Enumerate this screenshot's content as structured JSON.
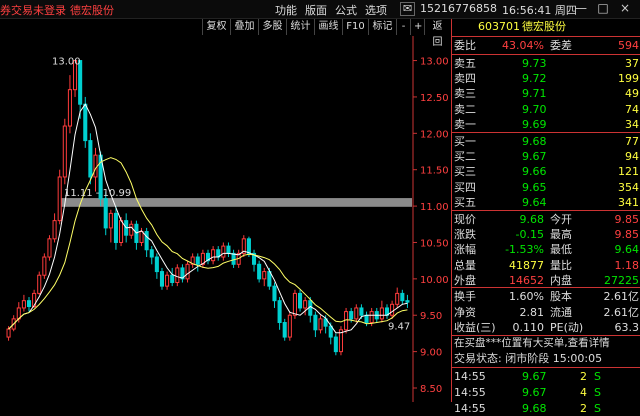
{
  "topbar": {
    "left_text": "券交易未登录",
    "stock_name": "德宏股份",
    "menu": [
      "功能",
      "版面",
      "公式",
      "选项"
    ],
    "phone": "15216776858",
    "time": "16:56:41 周四",
    "win_buttons": [
      "—",
      "□",
      "×"
    ]
  },
  "toolbar": {
    "buttons": [
      "复权",
      "叠加",
      "多股",
      "统计",
      "画线",
      "F10",
      "标记",
      "-",
      "+",
      "返回"
    ]
  },
  "chart": {
    "y_ticks": [
      "13.00",
      "12.50",
      "12.00",
      "11.50",
      "11.00",
      "10.50",
      "10.00",
      "9.50",
      "9.00",
      "8.50"
    ],
    "high_label": "13.00",
    "range_label": "11.11 - 10.99",
    "last_label": "9.47",
    "colors": {
      "up": "#ff3c3c",
      "down": "#00d0d0",
      "ma1": "#ffffff",
      "ma2": "#ffff66",
      "band": "#9a9a9a"
    }
  },
  "chart_data": {
    "type": "candlestick",
    "ylim": [
      8.5,
      13.2
    ],
    "candles": [
      [
        9.2,
        9.31,
        9.35,
        9.15
      ],
      [
        9.31,
        9.45,
        9.5,
        9.28
      ],
      [
        9.45,
        9.6,
        9.68,
        9.4
      ],
      [
        9.6,
        9.7,
        9.78,
        9.55
      ],
      [
        9.7,
        9.62,
        9.75,
        9.55
      ],
      [
        9.62,
        9.8,
        9.85,
        9.6
      ],
      [
        9.8,
        10.05,
        10.1,
        9.78
      ],
      [
        10.05,
        10.3,
        10.35,
        10.0
      ],
      [
        10.3,
        10.55,
        10.6,
        10.25
      ],
      [
        10.55,
        10.8,
        10.9,
        10.5
      ],
      [
        10.8,
        11.4,
        11.5,
        10.75
      ],
      [
        11.4,
        12.1,
        12.2,
        11.3
      ],
      [
        12.1,
        12.6,
        12.8,
        12.0
      ],
      [
        12.6,
        13.0,
        13.0,
        12.5
      ],
      [
        13.0,
        12.4,
        13.0,
        12.2
      ],
      [
        12.4,
        11.9,
        12.5,
        11.8
      ],
      [
        11.9,
        11.4,
        12.0,
        11.3
      ],
      [
        11.4,
        11.7,
        11.8,
        11.2
      ],
      [
        11.7,
        11.1,
        11.75,
        11.0
      ],
      [
        11.1,
        10.7,
        11.2,
        10.6
      ],
      [
        10.7,
        10.9,
        10.95,
        10.5
      ],
      [
        10.9,
        10.5,
        11.0,
        10.4
      ],
      [
        10.5,
        10.8,
        10.85,
        10.45
      ],
      [
        10.8,
        10.6,
        10.9,
        10.5
      ],
      [
        10.6,
        10.75,
        10.8,
        10.55
      ],
      [
        10.75,
        10.5,
        10.8,
        10.4
      ],
      [
        10.5,
        10.65,
        10.7,
        10.45
      ],
      [
        10.65,
        10.4,
        10.7,
        10.3
      ],
      [
        10.4,
        10.3,
        10.45,
        10.2
      ],
      [
        10.3,
        10.1,
        10.35,
        10.0
      ],
      [
        10.1,
        9.9,
        10.15,
        9.85
      ],
      [
        9.9,
        10.05,
        10.1,
        9.85
      ],
      [
        10.05,
        9.95,
        10.15,
        9.9
      ],
      [
        9.95,
        10.15,
        10.2,
        9.9
      ],
      [
        10.15,
        10.0,
        10.2,
        9.95
      ],
      [
        10.0,
        10.2,
        10.25,
        9.95
      ],
      [
        10.2,
        10.3,
        10.35,
        10.15
      ],
      [
        10.3,
        10.2,
        10.35,
        10.1
      ],
      [
        10.2,
        10.35,
        10.4,
        10.15
      ],
      [
        10.35,
        10.25,
        10.4,
        10.2
      ],
      [
        10.25,
        10.4,
        10.45,
        10.2
      ],
      [
        10.4,
        10.3,
        10.45,
        10.25
      ],
      [
        10.3,
        10.45,
        10.5,
        10.25
      ],
      [
        10.45,
        10.35,
        10.5,
        10.3
      ],
      [
        10.35,
        10.2,
        10.4,
        10.15
      ],
      [
        10.2,
        10.35,
        10.4,
        10.15
      ],
      [
        10.35,
        10.55,
        10.6,
        10.3
      ],
      [
        10.55,
        10.35,
        10.58,
        10.3
      ],
      [
        10.35,
        10.2,
        10.4,
        10.1
      ],
      [
        10.2,
        10.0,
        10.25,
        9.95
      ],
      [
        10.0,
        10.1,
        10.15,
        9.9
      ],
      [
        10.1,
        9.9,
        10.15,
        9.85
      ],
      [
        9.9,
        9.7,
        9.95,
        9.6
      ],
      [
        9.7,
        9.4,
        9.75,
        9.3
      ],
      [
        9.4,
        9.2,
        9.45,
        9.15
      ],
      [
        9.2,
        9.5,
        9.55,
        9.15
      ],
      [
        9.5,
        9.8,
        9.85,
        9.45
      ],
      [
        9.8,
        9.6,
        9.85,
        9.55
      ],
      [
        9.6,
        9.7,
        9.75,
        9.5
      ],
      [
        9.7,
        9.5,
        9.75,
        9.4
      ],
      [
        9.5,
        9.3,
        9.55,
        9.2
      ],
      [
        9.3,
        9.45,
        9.5,
        9.25
      ],
      [
        9.45,
        9.35,
        9.5,
        9.25
      ],
      [
        9.35,
        9.2,
        9.4,
        9.1
      ],
      [
        9.2,
        9.0,
        9.25,
        8.95
      ],
      [
        9.0,
        9.3,
        9.35,
        8.95
      ],
      [
        9.3,
        9.55,
        9.6,
        9.25
      ],
      [
        9.55,
        9.45,
        9.6,
        9.4
      ],
      [
        9.45,
        9.6,
        9.65,
        9.4
      ],
      [
        9.6,
        9.5,
        9.65,
        9.45
      ],
      [
        9.5,
        9.4,
        9.55,
        9.35
      ],
      [
        9.4,
        9.55,
        9.6,
        9.35
      ],
      [
        9.55,
        9.45,
        9.6,
        9.4
      ],
      [
        9.45,
        9.6,
        9.7,
        9.4
      ],
      [
        9.6,
        9.5,
        9.65,
        9.45
      ],
      [
        9.5,
        9.65,
        9.7,
        9.45
      ],
      [
        9.65,
        9.8,
        9.88,
        9.6
      ],
      [
        9.8,
        9.7,
        9.85,
        9.65
      ],
      [
        9.7,
        9.68,
        9.78,
        9.6
      ]
    ],
    "band": [
      10.99,
      11.11
    ]
  },
  "quote": {
    "code": "603701",
    "name": "德宏股份",
    "weibi_label": "委比",
    "weibi_val": "43.04%",
    "weicha_label": "委差",
    "weicha_val": "594",
    "asks": [
      {
        "label": "卖五",
        "price": "9.73",
        "vol": "37"
      },
      {
        "label": "卖四",
        "price": "9.72",
        "vol": "199"
      },
      {
        "label": "卖三",
        "price": "9.71",
        "vol": "49"
      },
      {
        "label": "卖二",
        "price": "9.70",
        "vol": "74"
      },
      {
        "label": "卖一",
        "price": "9.69",
        "vol": "34"
      }
    ],
    "bids": [
      {
        "label": "买一",
        "price": "9.68",
        "vol": "77"
      },
      {
        "label": "买二",
        "price": "9.67",
        "vol": "94"
      },
      {
        "label": "买三",
        "price": "9.66",
        "vol": "121"
      },
      {
        "label": "买四",
        "price": "9.65",
        "vol": "354"
      },
      {
        "label": "买五",
        "price": "9.64",
        "vol": "341"
      }
    ],
    "stats": [
      {
        "l1": "现价",
        "v1": "9.68",
        "l2": "今开",
        "v2": "9.85"
      },
      {
        "l1": "涨跌",
        "v1": "-0.15",
        "l2": "最高",
        "v2": "9.85"
      },
      {
        "l1": "涨幅",
        "v1": "-1.53%",
        "l2": "最低",
        "v2": "9.64"
      },
      {
        "l1": "总量",
        "v1": "41877",
        "l2": "量比",
        "v2": "1.18"
      },
      {
        "l1": "外盘",
        "v1": "14652",
        "l2": "内盘",
        "v2": "27225"
      }
    ],
    "stats2": [
      {
        "l1": "换手",
        "v1": "1.60%",
        "l2": "股本",
        "v2": "2.61亿"
      },
      {
        "l1": "净资",
        "v1": "2.81",
        "l2": "流通",
        "v2": "2.61亿"
      },
      {
        "l1": "收益(三)",
        "v1": "0.110",
        "l2": "PE(动)",
        "v2": "63.3"
      }
    ],
    "notice": "在买盘***位置有大买单,查看详情",
    "status": "交易状态: 闭市阶段 15:00:05",
    "trades": [
      {
        "time": "14:55",
        "price": "9.67",
        "vol": "2",
        "bs": "S"
      },
      {
        "time": "14:55",
        "price": "9.67",
        "vol": "4",
        "bs": "S"
      },
      {
        "time": "14:55",
        "price": "9.68",
        "vol": "2",
        "bs": "S"
      }
    ]
  }
}
